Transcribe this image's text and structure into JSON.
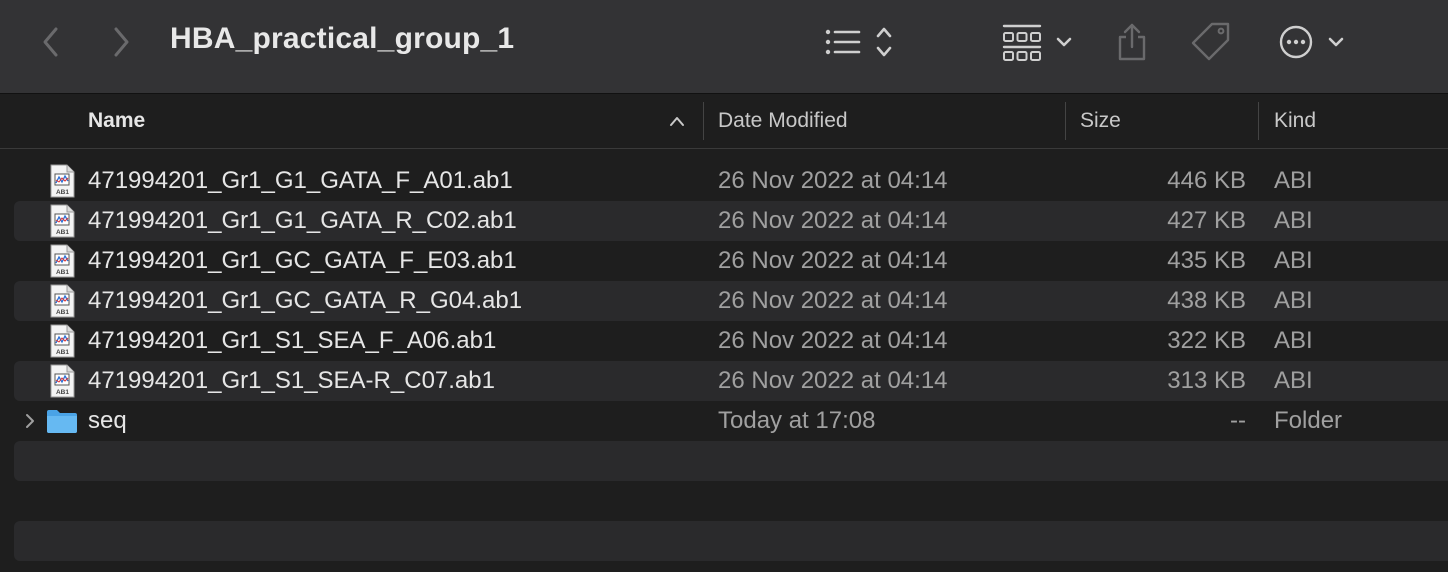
{
  "window": {
    "title": "HBA_practical_group_1"
  },
  "toolbar": {
    "back_icon": "chevron-left-icon",
    "forward_icon": "chevron-right-icon",
    "view_icon": "list-view-icon",
    "group_icon": "group-grid-icon",
    "share_icon": "share-icon",
    "tag_icon": "tag-icon",
    "more_icon": "more-ellipsis-icon"
  },
  "columns": {
    "name": "Name",
    "date_modified": "Date Modified",
    "size": "Size",
    "kind": "Kind",
    "sort_direction": "ascending"
  },
  "files": [
    {
      "name": "471994201_Gr1_G1_GATA_F_A01.ab1",
      "date": "26 Nov 2022 at 04:14",
      "size": "446 KB",
      "kind": "ABI",
      "icon_label": "AB1"
    },
    {
      "name": "471994201_Gr1_G1_GATA_R_C02.ab1",
      "date": "26 Nov 2022 at 04:14",
      "size": "427 KB",
      "kind": "ABI",
      "icon_label": "AB1"
    },
    {
      "name": "471994201_Gr1_GC_GATA_F_E03.ab1",
      "date": "26 Nov 2022 at 04:14",
      "size": "435 KB",
      "kind": "ABI",
      "icon_label": "AB1"
    },
    {
      "name": "471994201_Gr1_GC_GATA_R_G04.ab1",
      "date": "26 Nov 2022 at 04:14",
      "size": "438 KB",
      "kind": "ABI",
      "icon_label": "AB1"
    },
    {
      "name": "471994201_Gr1_S1_SEA_F_A06.ab1",
      "date": "26 Nov 2022 at 04:14",
      "size": "322 KB",
      "kind": "ABI",
      "icon_label": "AB1"
    },
    {
      "name": "471994201_Gr1_S1_SEA-R_C07.ab1",
      "date": "26 Nov 2022 at 04:14",
      "size": "313 KB",
      "kind": "ABI",
      "icon_label": "AB1"
    }
  ],
  "folders": [
    {
      "name": "seq",
      "date": "Today at 17:08",
      "size": "--",
      "kind": "Folder"
    }
  ],
  "colors": {
    "toolbar_bg": "#333335",
    "window_bg": "#1e1e1e",
    "stripe_bg": "#2a2a2c",
    "folder_blue": "#5fb3f0"
  }
}
